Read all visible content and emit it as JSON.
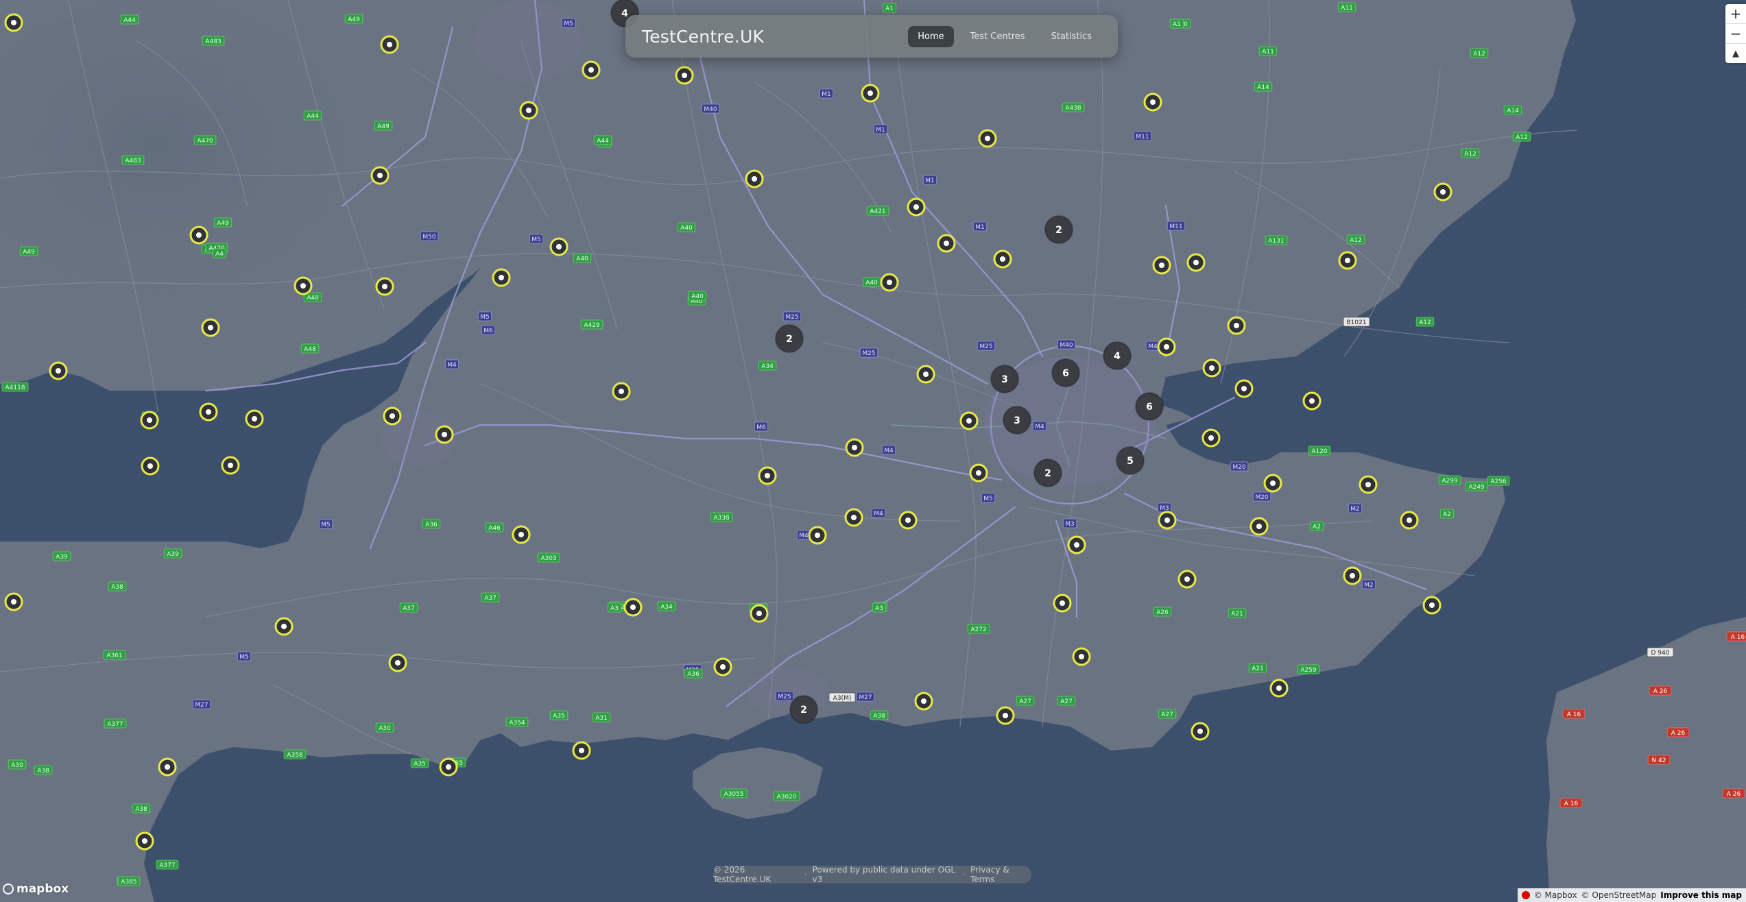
{
  "app": {
    "brand": "TestCentre.UK"
  },
  "nav": {
    "items": [
      {
        "label": "Home"
      },
      {
        "label": "Test Centres"
      },
      {
        "label": "Statistics"
      }
    ]
  },
  "footer": {
    "copyright": "© 2026 TestCentre.UK",
    "powered": "Powered by public data under OGL v3",
    "privacy": "Privacy & Terms",
    "separator": "·"
  },
  "map_controls": {
    "zoom_in": "+",
    "zoom_out": "−",
    "compass": "▲"
  },
  "attribution": {
    "mapbox": "© Mapbox",
    "osm": "© OpenStreetMap",
    "improve": "Improve this map",
    "logo": "mapbox"
  },
  "colors": {
    "sea": "#3c4f6b",
    "land": "#6a7382",
    "marker_ring": "#e8e84a",
    "cluster": "#3b3d42",
    "road_motorway": "#8a87c9",
    "road_primary": "#6bd06b"
  },
  "clusters": [
    {
      "count": "4"
    },
    {
      "count": "2"
    },
    {
      "count": "2"
    },
    {
      "count": "3"
    },
    {
      "count": "6"
    },
    {
      "count": "4"
    },
    {
      "count": "6"
    },
    {
      "count": "3"
    },
    {
      "count": "5"
    },
    {
      "count": "2"
    },
    {
      "count": "2"
    }
  ],
  "markers_count": 73,
  "road_labels": {
    "motorway": [
      "M5",
      "M1",
      "M40",
      "M1",
      "M1",
      "M1",
      "M11",
      "M11",
      "M50",
      "M5",
      "M5",
      "M40",
      "M40",
      "M25",
      "M25",
      "M25",
      "M4",
      "M4",
      "M4",
      "M4",
      "M5",
      "M3",
      "M3",
      "M20",
      "M20",
      "M2",
      "M2",
      "M25",
      "M25",
      "M27",
      "M27",
      "M5",
      "M5",
      "M6",
      "M6",
      "M4"
    ],
    "primary": [
      "A44",
      "A49",
      "A483",
      "A49",
      "A44",
      "A470",
      "A483",
      "A5",
      "A40",
      "A438",
      "A44",
      "A40",
      "A449",
      "A40",
      "A40",
      "A48",
      "A48",
      "A4118",
      "A49",
      "A429",
      "A40",
      "A421",
      "A1",
      "A11",
      "A11",
      "A14",
      "A14",
      "A12",
      "A12",
      "A12",
      "A131",
      "A12",
      "A12",
      "A120",
      "A249",
      "A2",
      "A2",
      "A299",
      "A256",
      "A21",
      "A21",
      "A259",
      "A27",
      "A27",
      "A26",
      "A272",
      "A3",
      "A32",
      "A338",
      "A34",
      "A36",
      "A303",
      "A37",
      "A37",
      "A36",
      "A30",
      "A39",
      "A39",
      "A38",
      "A361",
      "A377",
      "A386",
      "A3055",
      "A3020",
      "A31",
      "A35",
      "A354",
      "A35",
      "A358",
      "A35",
      "A30",
      "A377",
      "A38",
      "A385",
      "A470",
      "A49",
      "A38",
      "A34",
      "A34",
      "A46",
      "A40",
      "A1",
      "A38",
      "A6",
      "A3",
      "A3",
      "A27",
      "A4"
    ],
    "other": [
      "A3(M)",
      "B1021",
      "D 940"
    ],
    "french": [
      "A 16",
      "A 26",
      "A 26",
      "N 42",
      "A 16",
      "A 26",
      "A 16"
    ]
  }
}
